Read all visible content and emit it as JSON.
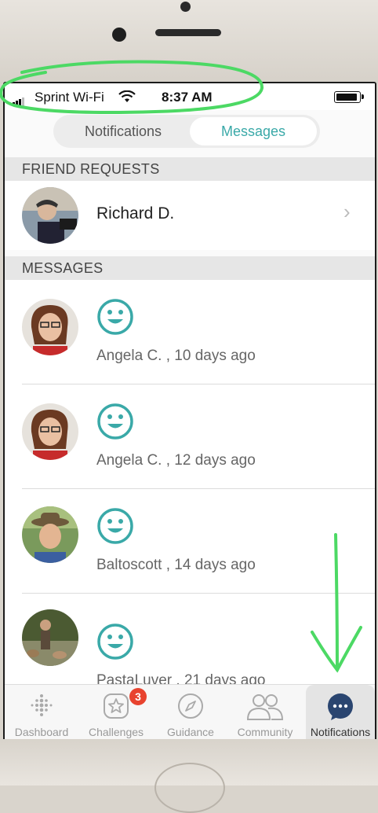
{
  "status_bar": {
    "carrier": "Sprint Wi-Fi",
    "time": "8:37 AM"
  },
  "tabs": {
    "left": "Notifications",
    "right": "Messages",
    "selected": "Messages"
  },
  "friend_requests": {
    "header": "FRIEND REQUESTS",
    "items": [
      {
        "name": "Richard D."
      }
    ]
  },
  "messages": {
    "header": "MESSAGES",
    "items": [
      {
        "sender": "Angela C.",
        "time": ", 10 days ago",
        "icon": "smiley-icon"
      },
      {
        "sender": "Angela C.",
        "time": ", 12 days ago",
        "icon": "smiley-icon"
      },
      {
        "sender": "Baltoscott",
        "time": ", 14 days ago",
        "icon": "smiley-icon"
      },
      {
        "sender": "PastaLuver",
        "time": ", 21 days ago",
        "icon": "smiley-icon"
      }
    ]
  },
  "bottom_nav": {
    "items": [
      {
        "label": "Dashboard",
        "icon": "dashboard-dots-icon"
      },
      {
        "label": "Challenges",
        "icon": "star-badge-icon",
        "badge": "3"
      },
      {
        "label": "Guidance",
        "icon": "compass-icon"
      },
      {
        "label": "Community",
        "icon": "people-icon"
      },
      {
        "label": "Notifications",
        "icon": "chat-bubble-icon",
        "active": true
      }
    ]
  },
  "colors": {
    "accent": "#3aa9a8",
    "badge": "#e8432f",
    "annotation": "#4cd964"
  }
}
